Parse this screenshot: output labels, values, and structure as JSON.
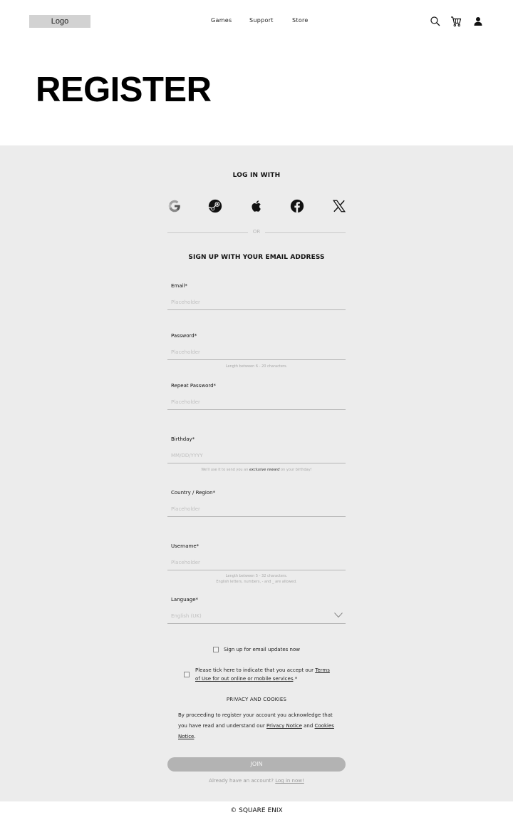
{
  "header": {
    "logo": "Logo",
    "nav": [
      "Games",
      "Support",
      "Store"
    ],
    "icons": [
      "search-icon",
      "cart-icon",
      "user-icon"
    ]
  },
  "page_title": "REGISTER",
  "login": {
    "heading": "LOG IN WITH",
    "providers": [
      "google-icon",
      "steam-icon",
      "apple-icon",
      "facebook-icon",
      "x-icon"
    ],
    "or": "OR"
  },
  "signup": {
    "heading": "SIGN UP WITH YOUR EMAIL ADDRESS",
    "fields": [
      {
        "label": "Email*",
        "placeholder": "Placeholder"
      },
      {
        "label": "Password*",
        "placeholder": "Placeholder",
        "hint": "Length between 6 - 20 characters."
      },
      {
        "label": "Repeat Password*",
        "placeholder": "Placeholder"
      },
      {
        "label": "Birthday*",
        "placeholder": "MM/DD/YYYY",
        "hint_pre": "We'll use it to send you an ",
        "hint_bold": "exclusive reward",
        "hint_post": " on your birthday!"
      },
      {
        "label": "Country / Region*",
        "placeholder": "Placeholder"
      },
      {
        "label": "Username*",
        "placeholder": "Placeholder",
        "hint_line1": "Length between 5 - 32 characters.",
        "hint_line2": "English letters, numbers, - and _ are allowed."
      },
      {
        "label": "Language*",
        "placeholder": "English (UK)"
      }
    ],
    "email_updates": "Sign up for email updates now",
    "terms_pre": "Please tick here to indicate that you accept our ",
    "terms_link": "Terms of Use for out online or mobile services",
    "terms_post": ".*",
    "privacy_heading": "PRIVACY AND COOKIES",
    "legal_pre": "By proceeding to register your account you acknowledge that you have read and understand our ",
    "privacy_link": "Privacy Notice",
    "legal_and": " and ",
    "cookies_link": "Cookies Notice",
    "legal_post": ".",
    "join": "JOIN",
    "already_text": "Already have an account? ",
    "login_link": "Log in now!"
  },
  "footer": "© SQUARE ENIX"
}
